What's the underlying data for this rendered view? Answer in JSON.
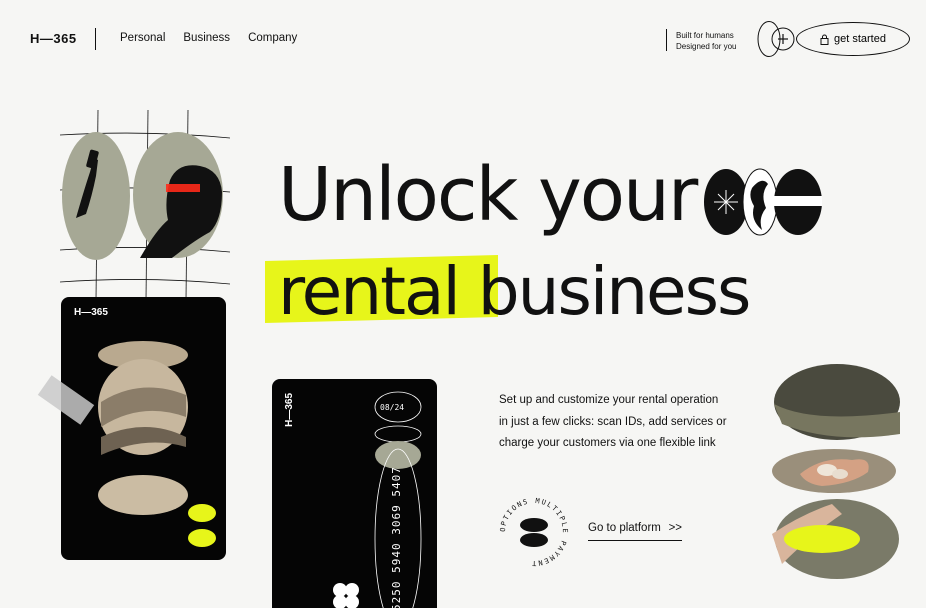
{
  "header": {
    "logo": "H—365",
    "nav": [
      "Personal",
      "Business",
      "Company"
    ],
    "tagline_line1": "Built for humans",
    "tagline_line2": "Designed for you",
    "cta_label": "get started"
  },
  "hero": {
    "headline_line1": "Unlock your",
    "headline_line2_highlight": "rental",
    "headline_line2_rest": "business",
    "description": "Set up and customize your rental operation in just a few clicks: scan IDs, add services or charge your customers via one flexible link",
    "badge_text": "OPTIONS MULTIPLE PAYMENT ",
    "link_label": "Go to platform",
    "link_arrow": ">>"
  },
  "cards": {
    "left_label": "H—365",
    "mid_label": "H—365",
    "expiry": "08/24",
    "card_number": "5250 5940 3069 5407"
  },
  "colors": {
    "accent": "#e7f51a",
    "ink": "#111111",
    "background": "#f6f6f4",
    "olive": "#a6a895"
  }
}
